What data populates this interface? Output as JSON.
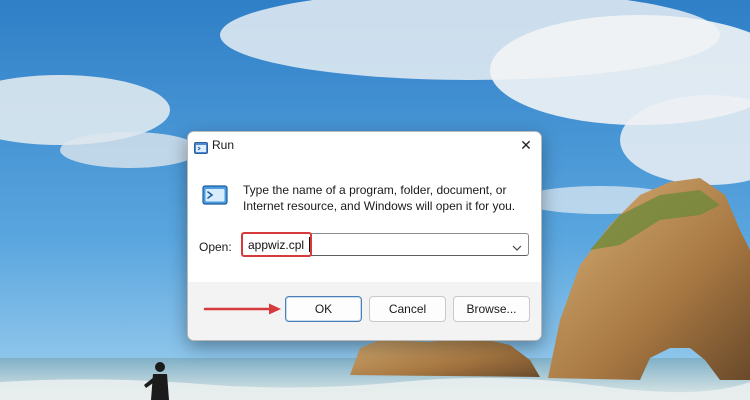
{
  "dialog": {
    "title": "Run",
    "description": "Type the name of a program, folder, document, or Internet resource, and Windows will open it for you.",
    "open_label": "Open:",
    "open_value": "appwiz.cpl",
    "buttons": {
      "ok": "OK",
      "cancel": "Cancel",
      "browse": "Browse..."
    }
  },
  "icons": {
    "title": "run-app-icon",
    "body": "run-app-icon",
    "close": "close-icon",
    "dropdown": "chevron-down-icon"
  },
  "colors": {
    "highlight": "#d63a3a",
    "arrow": "#d63a3a",
    "ok_border": "#4a7fb6"
  }
}
